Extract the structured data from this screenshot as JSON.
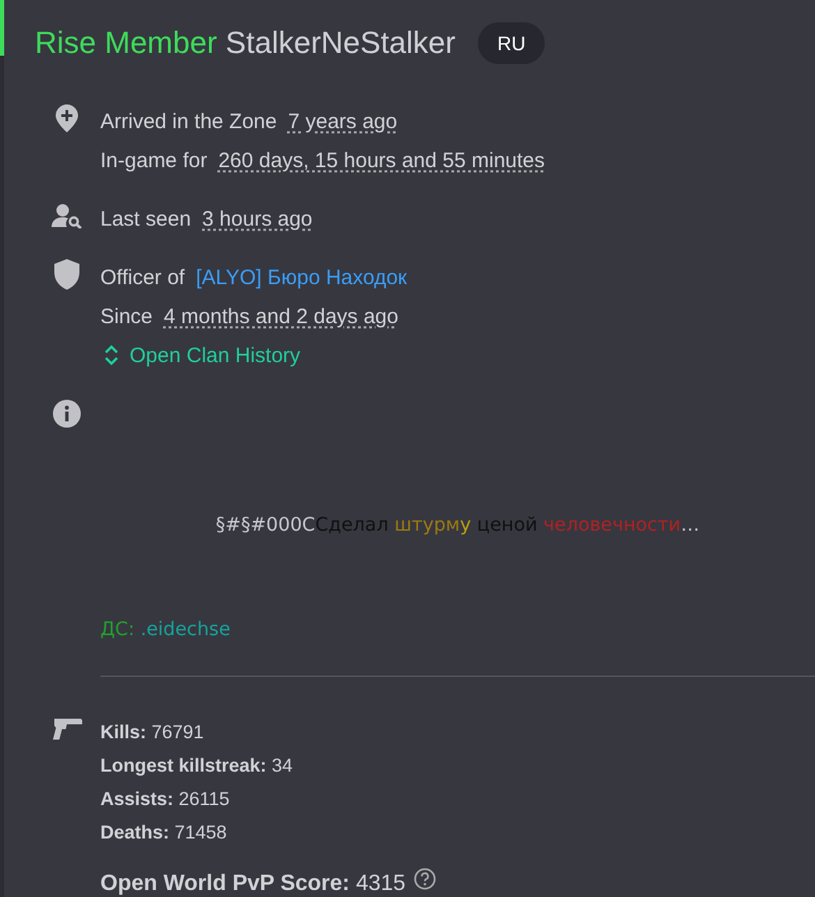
{
  "header": {
    "rank": "Rise Member",
    "name": "StalkerNeStalker",
    "region": "RU"
  },
  "arrival": {
    "label": "Arrived in the Zone",
    "value": "7 years ago"
  },
  "playtime": {
    "label": "In-game for",
    "value": "260 days, 15 hours and 55 minutes"
  },
  "last_seen": {
    "label": "Last seen",
    "value": "3 hours ago"
  },
  "clan": {
    "label": "Officer of",
    "name": "[ALYO] Бюро Находок",
    "since_label": "Since",
    "since_value": "4 months and 2 days ago",
    "history_link": "Open Clan History"
  },
  "bio": {
    "lines": [
      {
        "centered": true,
        "segments": [
          {
            "text": "§#§#000C",
            "color": "#c8c8cc"
          },
          {
            "text": "Сделал ",
            "color": "#101010"
          },
          {
            "text": "штурм",
            "color": "#9a7a12"
          },
          {
            "text": "у",
            "color": "#b8a010"
          },
          {
            "text": " ценой ",
            "color": "#101010"
          },
          {
            "text": "человечности",
            "color": "#b02222"
          },
          {
            "text": "…",
            "color": "#c8c8cc"
          }
        ]
      },
      {
        "centered": false,
        "segments": [
          {
            "text": "ДС: ",
            "color": "#1fa32a"
          },
          {
            "text": ".eidechse",
            "color": "#16a39a"
          }
        ]
      }
    ]
  },
  "stats": [
    {
      "label": "Kills:",
      "value": "76791"
    },
    {
      "label": "Longest killstreak:",
      "value": "34"
    },
    {
      "label": "Assists:",
      "value": "26115"
    },
    {
      "label": "Deaths:",
      "value": "71458"
    }
  ],
  "pvp_score": {
    "label": "Open World PvP Score:",
    "value": "4315"
  }
}
